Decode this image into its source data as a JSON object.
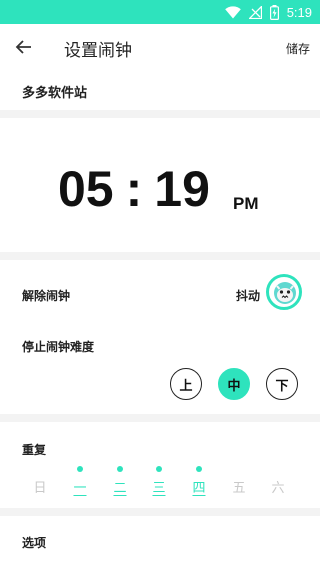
{
  "status_bar": {
    "time": "5:19",
    "color": "#2ee3bd"
  },
  "app_bar": {
    "title": "设置闹钟",
    "save_label": "储存"
  },
  "alarm": {
    "name": "多多软件站"
  },
  "time": {
    "hour": "05",
    "separator": ":",
    "minute": "19",
    "ampm": "PM"
  },
  "dismiss": {
    "label": "解除闹钟",
    "value": "抖动"
  },
  "difficulty": {
    "label": "停止闹钟难度",
    "options": [
      "上",
      "中",
      "下"
    ],
    "selected": "中"
  },
  "repeat": {
    "label": "重复",
    "days": [
      {
        "label": "日",
        "on": false
      },
      {
        "label": "一",
        "on": true
      },
      {
        "label": "二",
        "on": true
      },
      {
        "label": "三",
        "on": true
      },
      {
        "label": "四",
        "on": true
      },
      {
        "label": "五",
        "on": false
      },
      {
        "label": "六",
        "on": false
      }
    ]
  },
  "options": {
    "label": "选项"
  },
  "colors": {
    "accent": "#2ee3bd",
    "inactive_day": "#c9c9c9"
  }
}
